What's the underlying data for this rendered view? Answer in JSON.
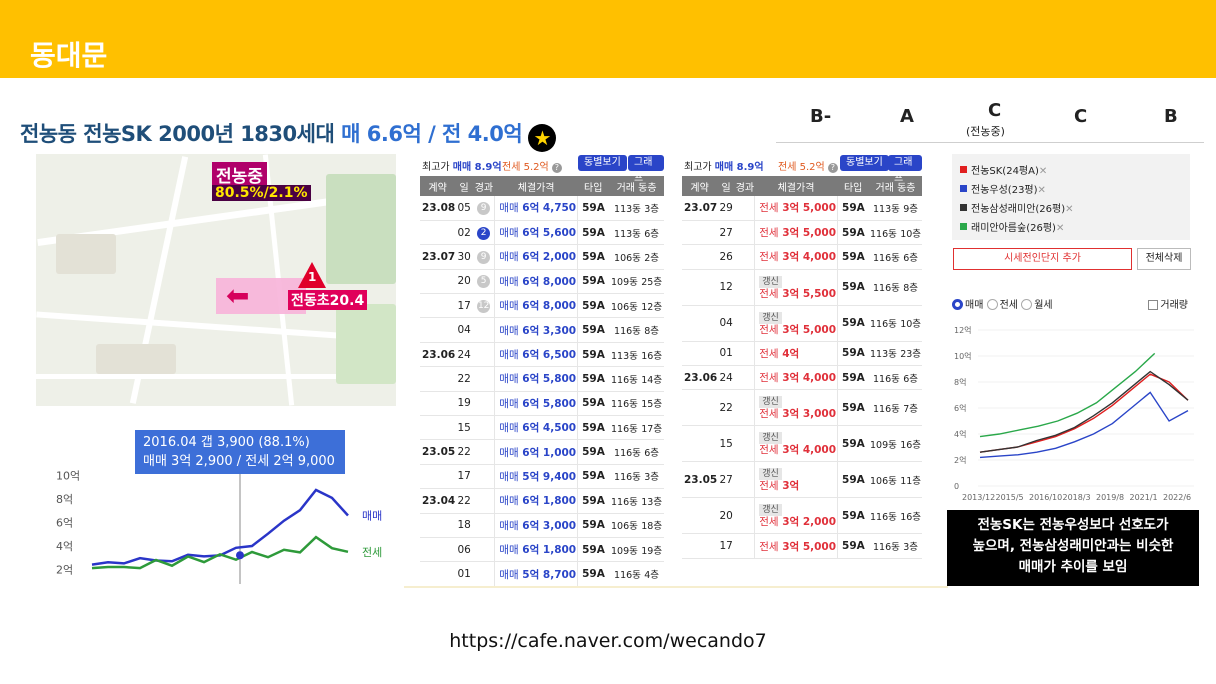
{
  "header": {
    "title": "동대문"
  },
  "headline": {
    "text": "전농동 전농SK 2000년 1830세대 ",
    "price": "매 6.6억 / 전 4.0억",
    "star": "★"
  },
  "map": {
    "school_name": "전농중",
    "school_ratio": "80.5%/2.1%",
    "marker_num": "1",
    "elem_label": "전동초20.4"
  },
  "left_chart": {
    "tooltip_line1": "2016.04  갭 3,900 (88.1%)",
    "tooltip_line2": "매매 3억 2,900 / 전세 2억 9,000",
    "yticks": [
      "10억",
      "8억",
      "6억",
      "4억",
      "2억"
    ],
    "series_labels": [
      "매매",
      "전세"
    ]
  },
  "table_left": {
    "max_label": "최고가",
    "max_sale": "매매 8.9억",
    "max_rent": "전세 5.2억",
    "btn_dong": "동별보기",
    "btn_graph": "그래프",
    "columns": [
      "계약",
      "일",
      "경과",
      "체결가격",
      "타입",
      "거래 동층"
    ],
    "rows": [
      {
        "ym": "23.08",
        "day": "05",
        "badge": "9",
        "blue": false,
        "kind": "매매",
        "price": "6억 4,750",
        "type": "59A",
        "dong": "113동",
        "floor": "3층"
      },
      {
        "ym": "",
        "day": "02",
        "badge": "2",
        "blue": true,
        "kind": "매매",
        "price": "6억 5,600",
        "type": "59A",
        "dong": "113동",
        "floor": "6층"
      },
      {
        "ym": "23.07",
        "day": "30",
        "badge": "9",
        "blue": false,
        "kind": "매매",
        "price": "6억 2,000",
        "type": "59A",
        "dong": "106동",
        "floor": "2층"
      },
      {
        "ym": "",
        "day": "20",
        "badge": "5",
        "blue": false,
        "kind": "매매",
        "price": "6억 8,000",
        "type": "59A",
        "dong": "109동",
        "floor": "25층"
      },
      {
        "ym": "",
        "day": "17",
        "badge": "12",
        "blue": false,
        "kind": "매매",
        "price": "6억 8,000",
        "type": "59A",
        "dong": "106동",
        "floor": "12층"
      },
      {
        "ym": "",
        "day": "04",
        "badge": "",
        "blue": false,
        "kind": "매매",
        "price": "6억 3,300",
        "type": "59A",
        "dong": "116동",
        "floor": "8층"
      },
      {
        "ym": "23.06",
        "day": "24",
        "badge": "",
        "blue": false,
        "kind": "매매",
        "price": "6억 6,500",
        "type": "59A",
        "dong": "113동",
        "floor": "16층"
      },
      {
        "ym": "",
        "day": "22",
        "badge": "",
        "blue": false,
        "kind": "매매",
        "price": "6억 5,800",
        "type": "59A",
        "dong": "116동",
        "floor": "14층"
      },
      {
        "ym": "",
        "day": "19",
        "badge": "",
        "blue": false,
        "kind": "매매",
        "price": "6억 5,800",
        "type": "59A",
        "dong": "116동",
        "floor": "15층"
      },
      {
        "ym": "",
        "day": "15",
        "badge": "",
        "blue": false,
        "kind": "매매",
        "price": "6억 4,500",
        "type": "59A",
        "dong": "116동",
        "floor": "17층"
      },
      {
        "ym": "23.05",
        "day": "22",
        "badge": "",
        "blue": false,
        "kind": "매매",
        "price": "6억 1,000",
        "type": "59A",
        "dong": "116동",
        "floor": "6층"
      },
      {
        "ym": "",
        "day": "17",
        "badge": "",
        "blue": false,
        "kind": "매매",
        "price": "5억 9,400",
        "type": "59A",
        "dong": "116동",
        "floor": "3층"
      },
      {
        "ym": "23.04",
        "day": "22",
        "badge": "",
        "blue": false,
        "kind": "매매",
        "price": "6억 1,800",
        "type": "59A",
        "dong": "116동",
        "floor": "13층"
      },
      {
        "ym": "",
        "day": "18",
        "badge": "",
        "blue": false,
        "kind": "매매",
        "price": "6억 3,000",
        "type": "59A",
        "dong": "106동",
        "floor": "18층"
      },
      {
        "ym": "",
        "day": "06",
        "badge": "",
        "blue": false,
        "kind": "매매",
        "price": "6억 1,800",
        "type": "59A",
        "dong": "109동",
        "floor": "19층"
      },
      {
        "ym": "",
        "day": "01",
        "badge": "",
        "blue": false,
        "kind": "매매",
        "price": "5억 8,700",
        "type": "59A",
        "dong": "116동",
        "floor": "4층"
      }
    ]
  },
  "table_right": {
    "max_label": "최고가",
    "max_sale": "매매 8.9억",
    "max_rent": "전세 5.2억",
    "btn_dong": "동별보기",
    "btn_graph": "그래프",
    "columns": [
      "계약",
      "일",
      "경과",
      "체결가격",
      "타입",
      "거래 동층"
    ],
    "rows": [
      {
        "ym": "23.07",
        "day": "29",
        "renew": "",
        "kind": "전세",
        "price": "3억 5,000",
        "type": "59A",
        "dong": "113동",
        "floor": "9층"
      },
      {
        "ym": "",
        "day": "27",
        "renew": "",
        "kind": "전세",
        "price": "3억 5,000",
        "type": "59A",
        "dong": "116동",
        "floor": "10층"
      },
      {
        "ym": "",
        "day": "26",
        "renew": "",
        "kind": "전세",
        "price": "3억 4,000",
        "type": "59A",
        "dong": "116동",
        "floor": "6층"
      },
      {
        "ym": "",
        "day": "12",
        "renew": "갱신",
        "kind": "전세",
        "price": "3억 5,500",
        "type": "59A",
        "dong": "116동",
        "floor": "8층"
      },
      {
        "ym": "",
        "day": "04",
        "renew": "갱신",
        "kind": "전세",
        "price": "3억 5,000",
        "type": "59A",
        "dong": "116동",
        "floor": "10층"
      },
      {
        "ym": "",
        "day": "01",
        "renew": "",
        "kind": "전세",
        "price": "4억",
        "type": "59A",
        "dong": "113동",
        "floor": "23층"
      },
      {
        "ym": "23.06",
        "day": "24",
        "renew": "",
        "kind": "전세",
        "price": "3억 4,000",
        "type": "59A",
        "dong": "116동",
        "floor": "6층"
      },
      {
        "ym": "",
        "day": "22",
        "renew": "갱신",
        "kind": "전세",
        "price": "3억 3,000",
        "type": "59A",
        "dong": "116동",
        "floor": "7층"
      },
      {
        "ym": "",
        "day": "15",
        "renew": "갱신",
        "kind": "전세",
        "price": "3억 4,000",
        "type": "59A",
        "dong": "109동",
        "floor": "16층"
      },
      {
        "ym": "23.05",
        "day": "27",
        "renew": "갱신",
        "kind": "전세",
        "price": "3억",
        "type": "59A",
        "dong": "106동",
        "floor": "11층"
      },
      {
        "ym": "",
        "day": "20",
        "renew": "갱신",
        "kind": "전세",
        "price": "3억 2,000",
        "type": "59A",
        "dong": "116동",
        "floor": "16층"
      },
      {
        "ym": "",
        "day": "17",
        "renew": "",
        "kind": "전세",
        "price": "3억 5,000",
        "type": "59A",
        "dong": "116동",
        "floor": "3층"
      }
    ]
  },
  "grades": {
    "items": [
      "B-",
      "A",
      "C",
      "C",
      "B"
    ],
    "sub": "(전농중)"
  },
  "legend": {
    "items": [
      {
        "label": "전농SK(24평A)",
        "color": "#e01f1f"
      },
      {
        "label": "전농우성(23평)",
        "color": "#2a45c8"
      },
      {
        "label": "전농삼성래미안(26평)",
        "color": "#333333"
      },
      {
        "label": "래미안아름숲(26평)",
        "color": "#2aa84a"
      }
    ],
    "x_mark": "✕",
    "add_button": "시세전인단지 추가",
    "delete_button": "전체삭제"
  },
  "radios": {
    "sale": "매매",
    "jeonse": "전세",
    "monthly": "월세",
    "volume": "거래량"
  },
  "right_chart": {
    "yticks": [
      "12억",
      "10억",
      "8억",
      "6억",
      "4억",
      "2억",
      "0"
    ],
    "xticks": [
      "2013/12",
      "2015/5",
      "2016/10",
      "2018/3",
      "2019/8",
      "2021/1",
      "2022/6"
    ]
  },
  "callout": {
    "line1": "전농SK는 전농우성보다 선호도가",
    "line2": "높으며, 전농삼성래미안과는 비슷한",
    "line3": "매매가 추이를 보임"
  },
  "footer": {
    "url": "https://cafe.naver.com/wecando7"
  },
  "chart_data": [
    {
      "type": "line",
      "yticks": [
        "10억",
        "8억",
        "6억",
        "4억",
        "2억"
      ],
      "ylim": [
        1,
        11
      ],
      "series": [
        {
          "name": "매매",
          "color": "#2a35c8",
          "values": [
            2.4,
            2.6,
            2.5,
            2.8,
            2.7,
            2.9,
            3.0,
            3.2,
            3.3,
            3.6,
            4.2,
            5.0,
            6.0,
            7.3,
            8.6,
            8.1,
            6.6
          ]
        },
        {
          "name": "전세",
          "color": "#2e9a3a",
          "values": [
            2.1,
            2.2,
            2.2,
            2.4,
            2.5,
            2.6,
            2.8,
            2.9,
            3.0,
            3.1,
            3.2,
            3.3,
            3.4,
            3.7,
            4.5,
            3.8,
            3.5
          ]
        }
      ]
    },
    {
      "type": "line",
      "xticks": [
        "2013/12",
        "2015/5",
        "2016/10",
        "2018/3",
        "2019/8",
        "2021/1",
        "2022/6"
      ],
      "yticks": [
        "12억",
        "10억",
        "8억",
        "6억",
        "4억",
        "2억",
        "0"
      ],
      "ylim": [
        0,
        12
      ],
      "series": [
        {
          "name": "전농SK(24평A)",
          "color": "#e01f1f",
          "values": [
            2.6,
            2.8,
            3.0,
            3.4,
            3.8,
            4.4,
            5.2,
            6.2,
            7.4,
            8.6,
            8.0,
            6.6
          ]
        },
        {
          "name": "전농우성(23평)",
          "color": "#2a45c8",
          "values": [
            2.2,
            2.3,
            2.4,
            2.6,
            2.9,
            3.4,
            4.0,
            4.8,
            6.0,
            7.2,
            5.0,
            5.8
          ]
        },
        {
          "name": "전농삼성래미안(26평)",
          "color": "#333333",
          "values": [
            2.6,
            2.8,
            3.0,
            3.5,
            3.9,
            4.5,
            5.4,
            6.4,
            7.6,
            8.8,
            7.8,
            6.6
          ]
        },
        {
          "name": "래미안아름숲(26평)",
          "color": "#2aa84a",
          "values": [
            3.8,
            4.0,
            4.3,
            4.6,
            5.0,
            5.6,
            6.4,
            7.6,
            8.8,
            10.2
          ]
        }
      ]
    }
  ]
}
